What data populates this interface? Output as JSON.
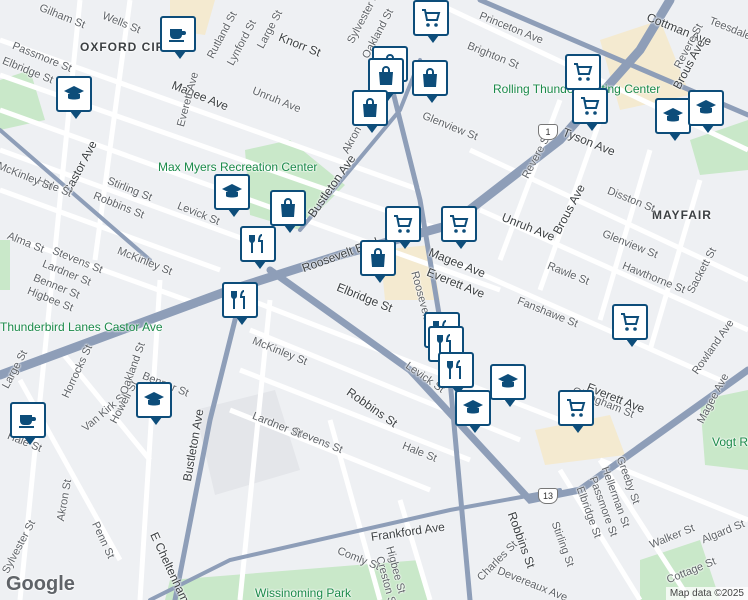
{
  "map": {
    "neighborhoods": [
      {
        "id": "oxford",
        "text": "OXFORD CIR"
      },
      {
        "id": "mayfair",
        "text": "MAYFAIR"
      }
    ],
    "streets": [
      {
        "id": "s1",
        "text": "Gilham St"
      },
      {
        "id": "s2",
        "text": "Wells St"
      },
      {
        "id": "s3",
        "text": "Rutland St"
      },
      {
        "id": "s4",
        "text": "Lynford St"
      },
      {
        "id": "s5",
        "text": "Large St"
      },
      {
        "id": "s6",
        "text": "Knorr St"
      },
      {
        "id": "s7",
        "text": "Unruh Ave"
      },
      {
        "id": "s8",
        "text": "Magee Ave"
      },
      {
        "id": "s9",
        "text": "Everett Ave"
      },
      {
        "id": "s10",
        "text": "Passmore St"
      },
      {
        "id": "s11",
        "text": "Elbridge St"
      },
      {
        "id": "s12",
        "text": "Sylvester St"
      },
      {
        "id": "s13",
        "text": "Oakland St"
      },
      {
        "id": "s14",
        "text": "Princeton Ave"
      },
      {
        "id": "s15",
        "text": "Brighton St"
      },
      {
        "id": "s16",
        "text": "Cottman Ave"
      },
      {
        "id": "s17",
        "text": "Teesdale St"
      },
      {
        "id": "s18",
        "text": "Brous Ave"
      },
      {
        "id": "s19",
        "text": "Revere St"
      },
      {
        "id": "s20",
        "text": "Tyson Ave"
      },
      {
        "id": "s21",
        "text": "Glenview St"
      },
      {
        "id": "s22",
        "text": "Akron St"
      },
      {
        "id": "s23",
        "text": "Bustleton Ave"
      },
      {
        "id": "s24",
        "text": "Roosevelt Blvd"
      },
      {
        "id": "s25",
        "text": "Castor Ave"
      },
      {
        "id": "s26",
        "text": "Hale St"
      },
      {
        "id": "s27",
        "text": "Stirling St"
      },
      {
        "id": "s28",
        "text": "McKinley St"
      },
      {
        "id": "s29",
        "text": "Robbins St"
      },
      {
        "id": "s30",
        "text": "Levick St"
      },
      {
        "id": "s31",
        "text": "Alma St"
      },
      {
        "id": "s32",
        "text": "Stevens St"
      },
      {
        "id": "s33",
        "text": "Lardner St"
      },
      {
        "id": "s34",
        "text": "Benner St"
      },
      {
        "id": "s35",
        "text": "Higbee St"
      },
      {
        "id": "s36",
        "text": "Disston St"
      },
      {
        "id": "s37",
        "text": "Hawthorne St"
      },
      {
        "id": "s38",
        "text": "Sackett St"
      },
      {
        "id": "s39",
        "text": "Fanshawe St"
      },
      {
        "id": "s40",
        "text": "Rawle St"
      },
      {
        "id": "s41",
        "text": "Rowland Ave"
      },
      {
        "id": "s42",
        "text": "Frankford Ave"
      },
      {
        "id": "s43",
        "text": "Comly St"
      },
      {
        "id": "s44",
        "text": "Creston St"
      },
      {
        "id": "s45",
        "text": "Charles St"
      },
      {
        "id": "s46",
        "text": "Walker St"
      },
      {
        "id": "s47",
        "text": "Algard St"
      },
      {
        "id": "s48",
        "text": "Greeby St"
      },
      {
        "id": "s49",
        "text": "Hellerman St"
      },
      {
        "id": "s50",
        "text": "E Cheltenham Ave"
      },
      {
        "id": "s51",
        "text": "Penn St"
      },
      {
        "id": "s52",
        "text": "Horrocks St"
      },
      {
        "id": "s53",
        "text": "Van Kirk St"
      },
      {
        "id": "s54",
        "text": "Howell St"
      },
      {
        "id": "s55",
        "text": "Gillingham St"
      },
      {
        "id": "s56",
        "text": "Devereaux Ave"
      },
      {
        "id": "s57",
        "text": "Cottage St"
      }
    ],
    "pois": [
      {
        "id": "p1",
        "text": "Rolling Thunder Skating Center"
      },
      {
        "id": "p2",
        "text": "Max Myers Recreation Center"
      },
      {
        "id": "p3",
        "text": "Thunderbird Lanes Castor Ave"
      },
      {
        "id": "p4",
        "text": "Vogt Recreation Center"
      },
      {
        "id": "p5",
        "text": "Wissinoming Park"
      }
    ],
    "route_shields": [
      {
        "id": "r1",
        "text": "1"
      },
      {
        "id": "r13",
        "text": "13"
      }
    ],
    "branding": "Google",
    "attribution": "Map data ©2025",
    "colors": {
      "arterial": "#8e9eb8",
      "road": "#ffffff",
      "park": "#c9e8c9",
      "commercial": "#f4ead0",
      "background": "#eef0f3",
      "pin": "#0d4d7a"
    },
    "pins": [
      {
        "id": "pin1",
        "icon": "cafe-icon"
      },
      {
        "id": "pin2",
        "icon": "shopping-cart-icon"
      },
      {
        "id": "pin3",
        "icon": "shopping-bag-icon"
      },
      {
        "id": "pin4",
        "icon": "shopping-bag-icon"
      },
      {
        "id": "pin5",
        "icon": "shopping-bag-icon"
      },
      {
        "id": "pin6",
        "icon": "school-icon"
      },
      {
        "id": "pin7",
        "icon": "shopping-cart-icon"
      },
      {
        "id": "pin8",
        "icon": "shopping-cart-icon"
      },
      {
        "id": "pin9",
        "icon": "school-icon"
      },
      {
        "id": "pin10",
        "icon": "school-icon"
      },
      {
        "id": "pin11",
        "icon": "school-icon"
      },
      {
        "id": "pin12",
        "icon": "shopping-bag-icon"
      },
      {
        "id": "pin13",
        "icon": "restaurant-icon"
      },
      {
        "id": "pin14",
        "icon": "shopping-cart-icon"
      },
      {
        "id": "pin15",
        "icon": "shopping-bag-icon"
      },
      {
        "id": "pin16",
        "icon": "shopping-bag-icon"
      },
      {
        "id": "pin17",
        "icon": "shopping-cart-icon"
      },
      {
        "id": "pin18",
        "icon": "restaurant-icon"
      },
      {
        "id": "pin19",
        "icon": "restaurant-icon"
      },
      {
        "id": "pin20",
        "icon": "restaurant-icon"
      },
      {
        "id": "pin21",
        "icon": "restaurant-icon"
      },
      {
        "id": "pin22",
        "icon": "restaurant-icon"
      },
      {
        "id": "pin23",
        "icon": "school-icon"
      },
      {
        "id": "pin24",
        "icon": "school-icon"
      },
      {
        "id": "pin25",
        "icon": "shopping-cart-icon"
      },
      {
        "id": "pin26",
        "icon": "shopping-cart-icon"
      },
      {
        "id": "pin27",
        "icon": "school-icon"
      },
      {
        "id": "pin28",
        "icon": "cafe-icon"
      }
    ]
  }
}
